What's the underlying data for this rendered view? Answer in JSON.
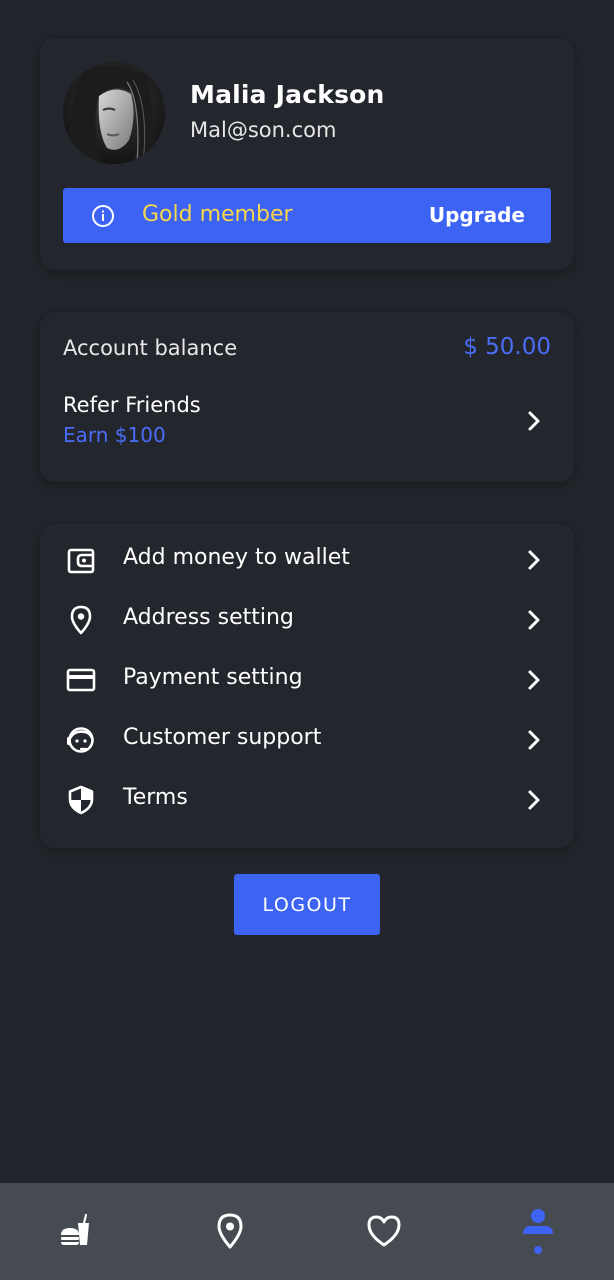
{
  "profile": {
    "name": "Malia Jackson",
    "email": "Mal@son.com",
    "membership_label": "Gold member",
    "upgrade_label": "Upgrade"
  },
  "balance": {
    "label": "Account balance",
    "value": "$ 50.00",
    "refer_title": "Refer Friends",
    "refer_subtitle": "Earn $100"
  },
  "menu": {
    "items": [
      {
        "label": "Add money to wallet",
        "icon": "wallet-icon"
      },
      {
        "label": "Address setting",
        "icon": "location-pin-icon"
      },
      {
        "label": "Payment setting",
        "icon": "credit-card-icon"
      },
      {
        "label": "Customer support",
        "icon": "support-agent-icon"
      },
      {
        "label": "Terms",
        "icon": "shield-icon"
      }
    ]
  },
  "logout_label": "LOGOUT",
  "bottom_nav": {
    "items": [
      {
        "icon": "food-drink-icon",
        "active": false
      },
      {
        "icon": "location-pin-icon",
        "active": false
      },
      {
        "icon": "heart-icon",
        "active": false
      },
      {
        "icon": "person-icon",
        "active": true
      }
    ]
  },
  "colors": {
    "background": "#22252b",
    "accent": "#3d63f5",
    "gold": "#f5d64a",
    "nav_background": "#464a51"
  }
}
